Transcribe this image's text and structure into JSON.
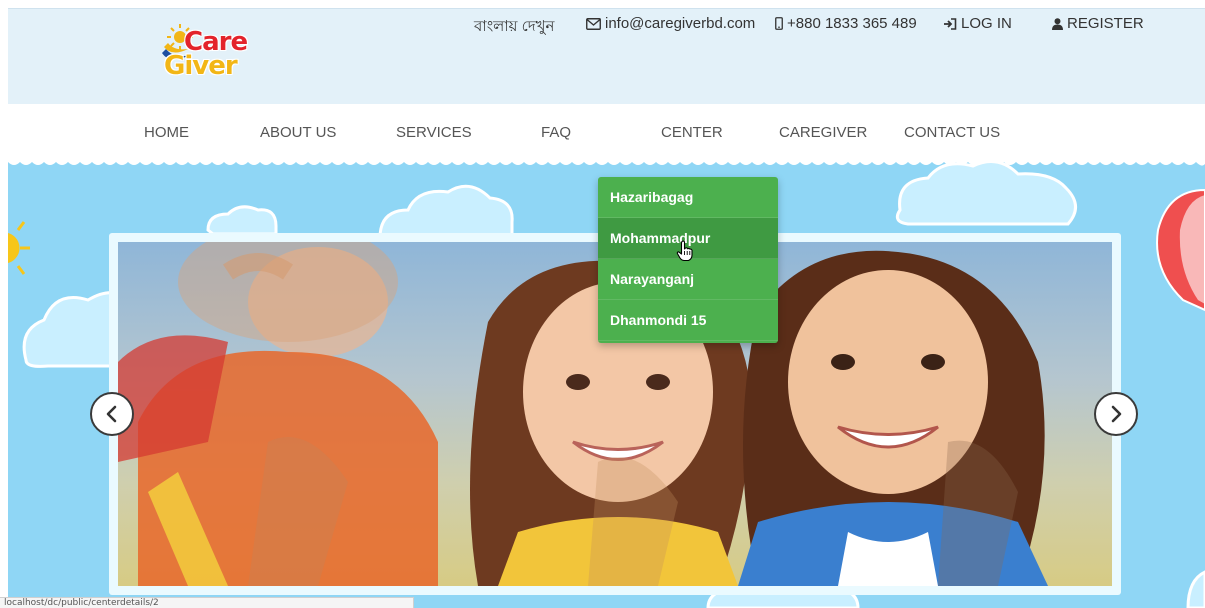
{
  "header": {
    "logo": {
      "line1": "Care",
      "line2": "Giver"
    },
    "links": {
      "language": "বাংলায় দেখুন",
      "email": "info@caregiverbd.com",
      "phone": "+880 1833 365 489",
      "login": "LOG IN",
      "register": "REGISTER"
    }
  },
  "nav": {
    "items": [
      "HOME",
      "ABOUT US",
      "SERVICES",
      "FAQ",
      "CENTER",
      "CAREGIVER",
      "CONTACT US"
    ]
  },
  "dropdown": {
    "items": [
      "Hazaribagag",
      "Mohammadpur",
      "Narayanganj",
      "Dhanmondi 15"
    ],
    "hovered_index": 1
  },
  "slider": {
    "prev_icon": "chevron-left-icon",
    "next_icon": "chevron-right-icon"
  },
  "statusbar": {
    "url": "localhost/dc/public/centerdetails/2"
  },
  "colors": {
    "header_bg": "#e3f1f9",
    "hero_bg": "#8fd6f5",
    "dropdown_bg": "#4cb04e",
    "dropdown_active": "#3f9a42",
    "logo_red": "#e3232b",
    "logo_yellow": "#f2b616"
  }
}
